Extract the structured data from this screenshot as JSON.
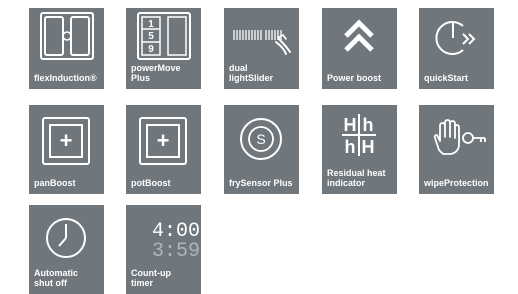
{
  "features": [
    {
      "label": "flexInduction®",
      "icon": "flex-induction-icon"
    },
    {
      "label": "powerMove\nPlus",
      "icon": "power-move-icon",
      "zones": [
        "1",
        "5",
        "9"
      ]
    },
    {
      "label": "dual\nlightSlider",
      "icon": "light-slider-icon"
    },
    {
      "label": "Power boost",
      "icon": "double-chevron-up-icon"
    },
    {
      "label": "quickStart",
      "icon": "quick-start-icon"
    },
    {
      "label": "panBoost",
      "icon": "pan-boost-icon",
      "symbol": "+"
    },
    {
      "label": "potBoost",
      "icon": "pot-boost-icon",
      "symbol": "+"
    },
    {
      "label": "frySensor Plus",
      "icon": "fry-sensor-icon",
      "symbol": "S"
    },
    {
      "label": "Residual heat\nindicator",
      "icon": "residual-heat-icon",
      "glyphs": [
        "H",
        "h",
        "h",
        "H"
      ]
    },
    {
      "label": "wipeProtection",
      "icon": "hand-key-icon"
    },
    {
      "label": "Automatic\nshut off",
      "icon": "clock-icon"
    },
    {
      "label": "Count-up\ntimer",
      "icon": "timer-display-icon",
      "display": [
        "4:00",
        "3:59"
      ]
    }
  ],
  "colors": {
    "tile": "#6f767c",
    "foreground": "#ffffff"
  }
}
